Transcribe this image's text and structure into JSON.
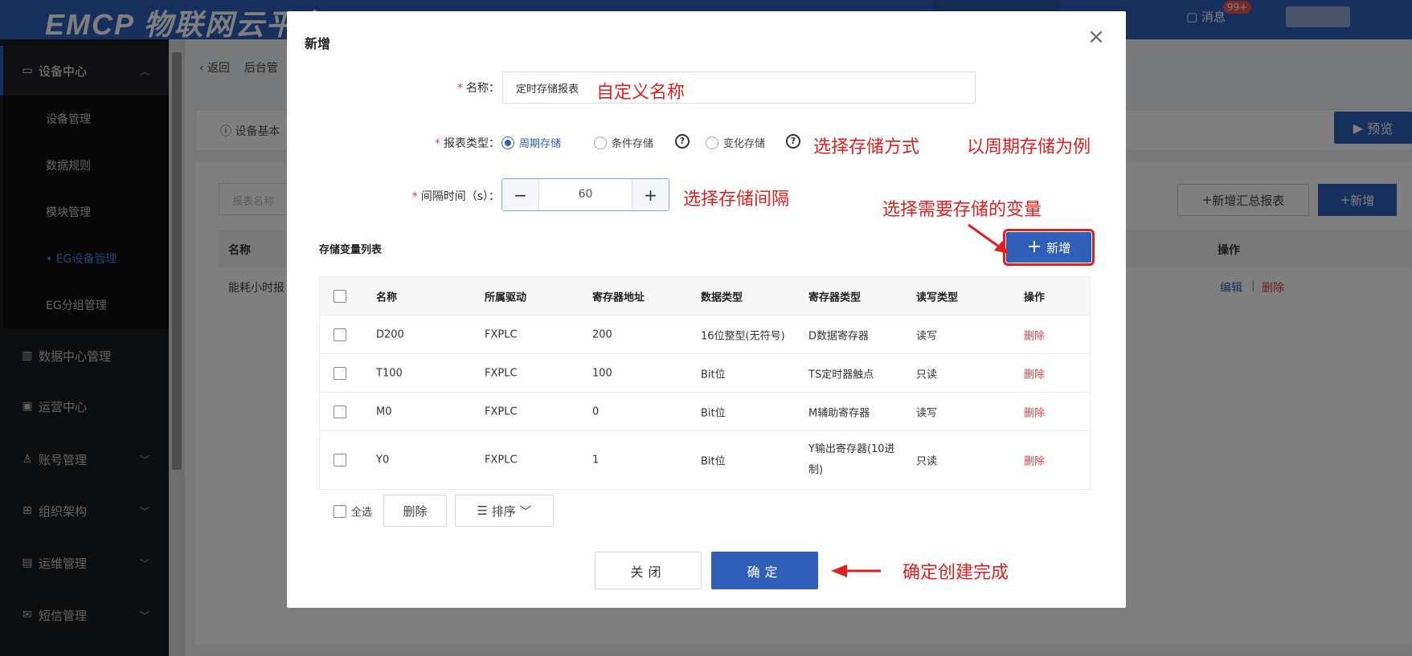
{
  "topbar": {
    "logo": "EMCP 物联网云平台",
    "messages_label": "消息",
    "messages_badge": "99+"
  },
  "sidebar": {
    "device_center": "设备中心",
    "sub_items": [
      "设备管理",
      "数据规则",
      "模块管理",
      "• EG设备管理",
      "EG分组管理"
    ],
    "groups": [
      "数据中心管理",
      "运营中心",
      "账号管理",
      "组织架构",
      "运维管理",
      "短信管理"
    ]
  },
  "background": {
    "back": "返回",
    "breadcrumb": "后台管",
    "card_title": "设备基本",
    "preview": "预览",
    "search_placeholder": "报表名称",
    "add_summary": "新增汇总报表",
    "add": "新增",
    "col_name": "名称",
    "col_ops": "操作",
    "row_name": "能耗小时报",
    "row_edit": "编辑",
    "row_delete": "删除"
  },
  "modal": {
    "title": "新增",
    "close_icon": "×",
    "name_label": "名称：",
    "name_value": "定时存储报表",
    "type_label": "报表类型：",
    "type_options": [
      "周期存储",
      "条件存储",
      "变化存储"
    ],
    "type_selected": "周期存储",
    "interval_label": "间隔时间（s）：",
    "interval_value": "60",
    "list_title": "存储变量列表",
    "add_var_button": "新增",
    "table": {
      "headers": [
        "名称",
        "所属驱动",
        "寄存器地址",
        "数据类型",
        "寄存器类型",
        "读写类型",
        "操作"
      ],
      "rows": [
        {
          "name": "D200",
          "driver": "FXPLC",
          "address": "200",
          "data_type": "16位整型(无符号)",
          "reg_type": "D数据寄存器",
          "rw": "读写",
          "op": "删除"
        },
        {
          "name": "T100",
          "driver": "FXPLC",
          "address": "100",
          "data_type": "Bit位",
          "reg_type": "TS定时器触点",
          "rw": "只读",
          "op": "删除"
        },
        {
          "name": "M0",
          "driver": "FXPLC",
          "address": "0",
          "data_type": "Bit位",
          "reg_type": "M辅助寄存器",
          "rw": "读写",
          "op": "删除"
        },
        {
          "name": "Y0",
          "driver": "FXPLC",
          "address": "1",
          "data_type": "Bit位",
          "reg_type": "Y输出寄存器(10进制)",
          "rw": "只读",
          "op": "删除"
        }
      ]
    },
    "select_all": "全选",
    "delete_button": "删除",
    "sort_button": "排序",
    "cancel_button": "关闭",
    "confirm_button": "确定"
  },
  "annotations": {
    "custom_name": "自定义名称",
    "choose_storage": "选择存储方式",
    "periodic_example": "以周期存储为例",
    "choose_interval": "选择存储间隔",
    "choose_vars": "选择需要存储的变量",
    "confirm_done": "确定创建完成"
  },
  "colors": {
    "primary": "#2f5fb8",
    "danger": "#e04040",
    "annotation": "#e02020",
    "sidebar_bg": "#1b1c20"
  }
}
